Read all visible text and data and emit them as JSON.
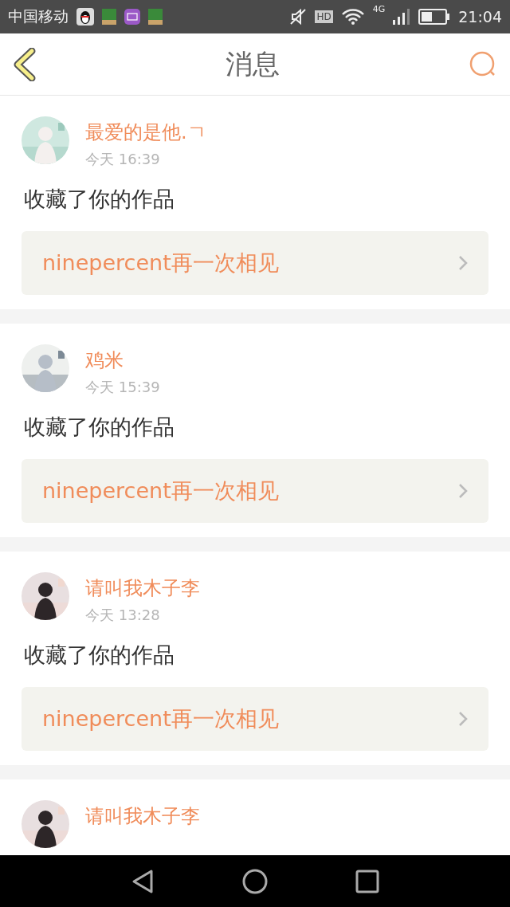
{
  "status_bar": {
    "carrier": "中国移动",
    "network": "4G",
    "hd": "HD",
    "time": "21:04"
  },
  "header": {
    "title": "消息"
  },
  "messages": [
    {
      "name": "最爱的是他.ㄱ",
      "time": "今天 16:39",
      "action": "收藏了你的作品",
      "work": "ninepercent再一次相见"
    },
    {
      "name": "鸡米",
      "time": "今天 15:39",
      "action": "收藏了你的作品",
      "work": "ninepercent再一次相见"
    },
    {
      "name": "请叫我木子李",
      "time": "今天 13:28",
      "action": "收藏了你的作品",
      "work": "ninepercent再一次相见"
    },
    {
      "name": "请叫我木子李"
    }
  ]
}
